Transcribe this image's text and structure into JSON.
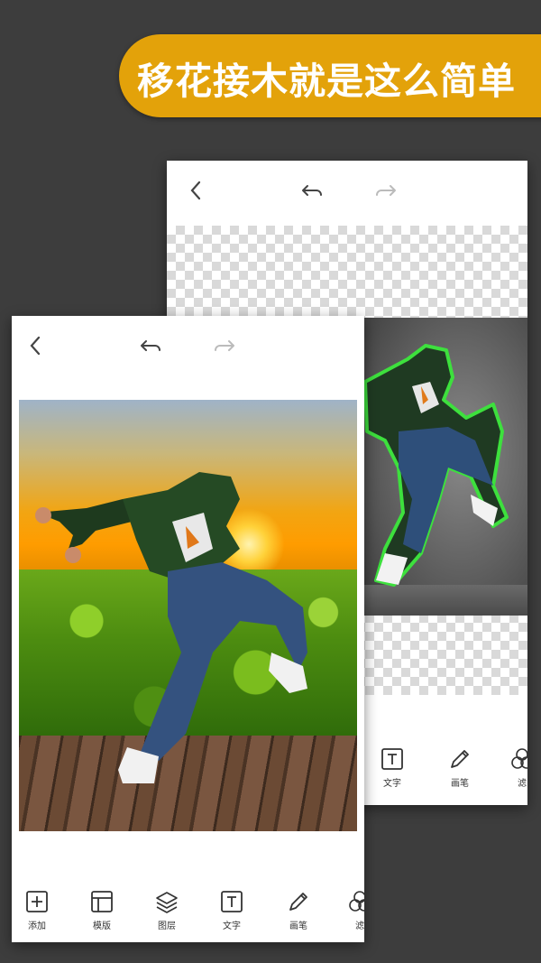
{
  "banner": {
    "text": "移花接木就是这么简单",
    "color": "#e3a20a"
  },
  "back_card": {
    "toolbar": [
      {
        "icon": "text-icon",
        "label": "文字"
      },
      {
        "icon": "brush-icon",
        "label": "画笔"
      },
      {
        "icon": "filter-icon",
        "label": "滤"
      }
    ]
  },
  "front_card": {
    "toolbar": [
      {
        "icon": "add-icon",
        "label": "添加"
      },
      {
        "icon": "template-icon",
        "label": "模版"
      },
      {
        "icon": "layers-icon",
        "label": "图层"
      },
      {
        "icon": "text-icon",
        "label": "文字"
      },
      {
        "icon": "brush-icon",
        "label": "画笔"
      },
      {
        "icon": "filter-icon",
        "label": "滤"
      }
    ]
  },
  "colors": {
    "background": "#3d3d3d",
    "accent": "#e3a20a",
    "selection_outline": "#3de03d"
  }
}
